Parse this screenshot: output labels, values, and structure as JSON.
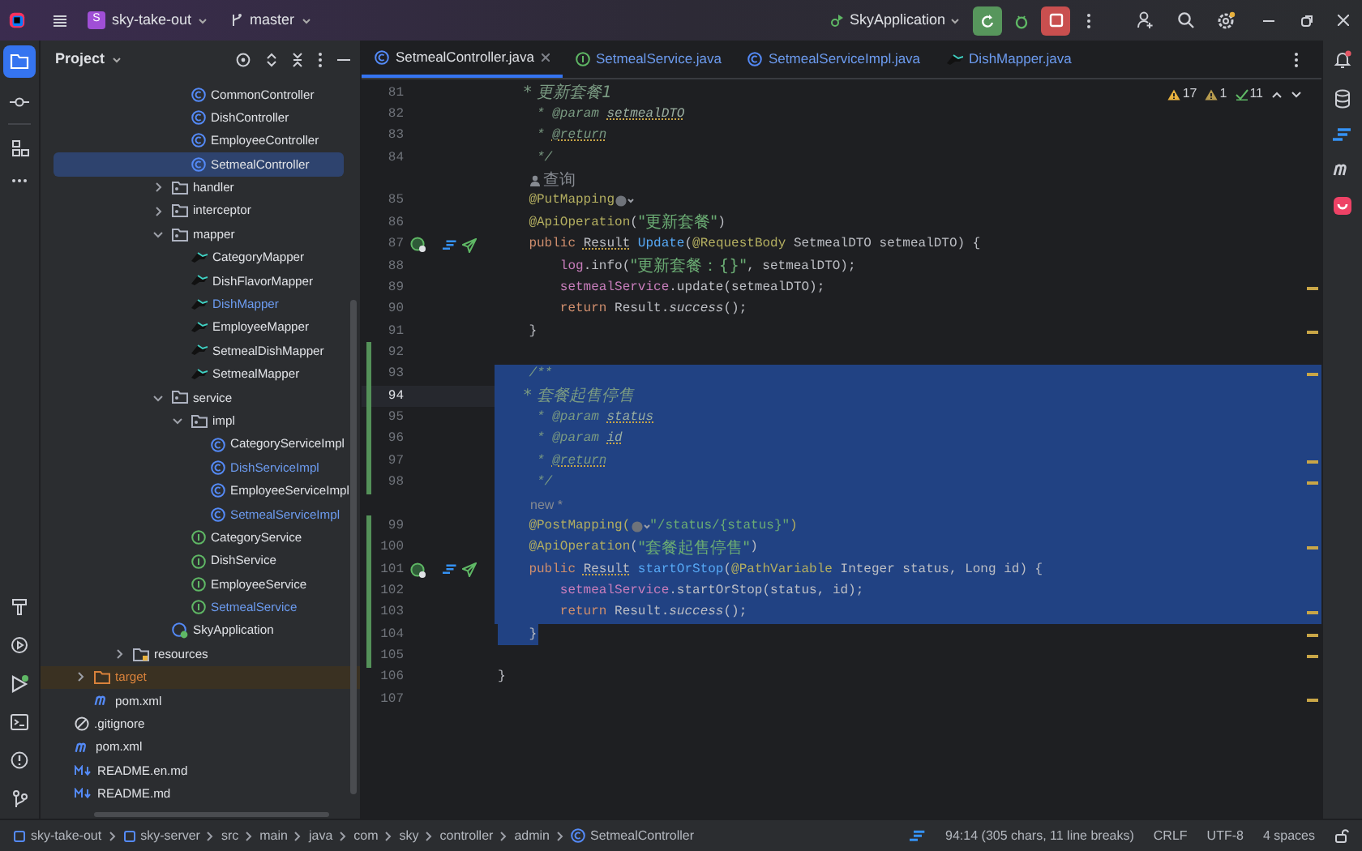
{
  "title_bar": {
    "project_badge": "S",
    "project": "sky-take-out",
    "branch": "master",
    "run_config": "SkyApplication"
  },
  "tool_window": {
    "title": "Project"
  },
  "tree": [
    {
      "children": [
        {
          "children": [
            {
              "children": [
                {
                  "children": [
                    {
                      "children": [
                        {
                          "children": [
                            {
                              "label": "CommonController",
                              "kind": "class",
                              "modified": false,
                              "selected": false
                            },
                            {
                              "label": "DishController",
                              "kind": "class",
                              "modified": false,
                              "selected": false
                            },
                            {
                              "label": "EmployeeController",
                              "kind": "class",
                              "modified": false,
                              "selected": false
                            },
                            {
                              "label": "SetmealController",
                              "kind": "class",
                              "modified": false,
                              "selected": true
                            }
                          ]
                        },
                        {
                          "label": "handler",
                          "kind": "package",
                          "modified": false,
                          "selected": false,
                          "expanded": false
                        },
                        {
                          "label": "interceptor",
                          "kind": "package",
                          "modified": false,
                          "selected": false,
                          "expanded": false
                        },
                        {
                          "label": "mapper",
                          "kind": "package",
                          "modified": false,
                          "selected": false,
                          "expanded": true,
                          "children": [
                            {
                              "label": "CategoryMapper",
                              "kind": "mapper",
                              "modified": false,
                              "selected": false
                            },
                            {
                              "label": "DishFlavorMapper",
                              "kind": "mapper",
                              "modified": false,
                              "selected": false
                            },
                            {
                              "label": "DishMapper",
                              "kind": "mapper",
                              "modified": true,
                              "selected": false
                            },
                            {
                              "label": "EmployeeMapper",
                              "kind": "mapper",
                              "modified": false,
                              "selected": false
                            },
                            {
                              "label": "SetmealDishMapper",
                              "kind": "mapper",
                              "modified": false,
                              "selected": false
                            },
                            {
                              "label": "SetmealMapper",
                              "kind": "mapper",
                              "modified": false,
                              "selected": false
                            }
                          ]
                        },
                        {
                          "label": "service",
                          "kind": "package",
                          "modified": false,
                          "selected": false,
                          "expanded": true,
                          "children": [
                            {
                              "label": "impl",
                              "kind": "package",
                              "modified": false,
                              "selected": false,
                              "expanded": true,
                              "children": [
                                {
                                  "label": "CategoryServiceImpl",
                                  "kind": "class",
                                  "modified": false,
                                  "selected": false
                                },
                                {
                                  "label": "DishServiceImpl",
                                  "kind": "class",
                                  "modified": true,
                                  "selected": false
                                },
                                {
                                  "label": "EmployeeServiceImpl",
                                  "kind": "class",
                                  "modified": false,
                                  "selected": false
                                },
                                {
                                  "label": "SetmealServiceImpl",
                                  "kind": "class",
                                  "modified": true,
                                  "selected": false
                                }
                              ]
                            },
                            {
                              "label": "CategoryService",
                              "kind": "interface",
                              "modified": false,
                              "selected": false
                            },
                            {
                              "label": "DishService",
                              "kind": "interface",
                              "modified": false,
                              "selected": false
                            },
                            {
                              "label": "EmployeeService",
                              "kind": "interface",
                              "modified": false,
                              "selected": false
                            },
                            {
                              "label": "SetmealService",
                              "kind": "interface",
                              "modified": true,
                              "selected": false
                            }
                          ]
                        },
                        {
                          "label": "SkyApplication",
                          "kind": "app",
                          "modified": false,
                          "selected": false
                        }
                      ]
                    }
                  ]
                },
                {
                  "label": "resources",
                  "kind": "resources",
                  "modified": false,
                  "selected": false,
                  "expanded": false
                }
              ]
            }
          ]
        },
        {
          "label": "target",
          "kind": "excluded_folder",
          "modified": false,
          "selected": false,
          "expanded": false
        },
        {
          "label": "pom.xml",
          "kind": "maven",
          "modified": false,
          "selected": false
        }
      ]
    },
    {
      "label": ".gitignore",
      "kind": "ignore",
      "modified": false,
      "selected": false
    },
    {
      "label": "pom.xml",
      "kind": "maven",
      "modified": false,
      "selected": false
    },
    {
      "label": "README.en.md",
      "kind": "markdown",
      "modified": false,
      "selected": false
    },
    {
      "label": "README.md",
      "kind": "markdown",
      "modified": false,
      "selected": false
    }
  ],
  "tabs": [
    {
      "label": "SetmealController.java",
      "kind": "class",
      "selected": true
    },
    {
      "label": "SetmealService.java",
      "kind": "interface",
      "selected": false
    },
    {
      "label": "SetmealServiceImpl.java",
      "kind": "class",
      "selected": false
    },
    {
      "label": "DishMapper.java",
      "kind": "mapper",
      "selected": false
    }
  ],
  "inspections": [
    {
      "kind": "warning",
      "count": "17"
    },
    {
      "kind": "weak",
      "count": "1"
    },
    {
      "kind": "ok",
      "count": "11"
    }
  ],
  "code": [
    {
      "kind": "code",
      "number": "81",
      "selected": false,
      "selected_to_end": false,
      "current": false,
      "changed": false,
      "run_markers": false,
      "stripe": false,
      "segments": [
        {
          "kind": "comment",
          "text": "     * 更新套餐1"
        }
      ]
    },
    {
      "kind": "code",
      "number": "82",
      "selected": false,
      "selected_to_end": false,
      "current": false,
      "changed": false,
      "run_markers": false,
      "stripe": false,
      "segments": [
        {
          "kind": "comment",
          "text": "     * "
        },
        {
          "kind": "comment_tag",
          "text": "@param "
        },
        {
          "kind": "comment_ref",
          "text": "setmealDTO"
        }
      ]
    },
    {
      "kind": "code",
      "number": "83",
      "selected": false,
      "selected_to_end": false,
      "current": false,
      "changed": false,
      "run_markers": false,
      "stripe": false,
      "segments": [
        {
          "kind": "comment",
          "text": "     * "
        },
        {
          "kind": "comment_tag_warn",
          "text": "@return"
        }
      ]
    },
    {
      "kind": "code",
      "number": "84",
      "selected": false,
      "selected_to_end": false,
      "current": false,
      "changed": false,
      "run_markers": false,
      "stripe": false,
      "segments": [
        {
          "kind": "comment",
          "text": "     */"
        }
      ]
    },
    {
      "kind": "author_hint",
      "text": "查询",
      "selected": false,
      "selected_to_end": false
    },
    {
      "kind": "code",
      "number": "85",
      "selected": false,
      "selected_to_end": false,
      "current": false,
      "changed": false,
      "run_markers": false,
      "stripe": false,
      "segments": [
        {
          "kind": "annotation",
          "text": "    @PutMapping"
        },
        {
          "kind": "globe"
        }
      ]
    },
    {
      "kind": "code",
      "number": "86",
      "selected": false,
      "selected_to_end": false,
      "current": false,
      "changed": false,
      "run_markers": false,
      "stripe": false,
      "segments": [
        {
          "kind": "annotation",
          "text": "    @ApiOperation"
        },
        {
          "kind": "plain",
          "text": "("
        },
        {
          "kind": "string",
          "text": "\"更新套餐\""
        },
        {
          "kind": "plain",
          "text": ")"
        }
      ]
    },
    {
      "kind": "code",
      "number": "87",
      "selected": false,
      "selected_to_end": false,
      "current": false,
      "changed": false,
      "run_markers": true,
      "stripe": false,
      "segments": [
        {
          "kind": "keyword",
          "text": "    public "
        },
        {
          "kind": "type_warn",
          "text": "Result"
        },
        {
          "kind": "method",
          "text": " Update"
        },
        {
          "kind": "plain",
          "text": "("
        },
        {
          "kind": "annotation",
          "text": "@RequestBody"
        },
        {
          "kind": "plain",
          "text": " SetmealDTO setmealDTO) {"
        }
      ]
    },
    {
      "kind": "code",
      "number": "88",
      "selected": false,
      "selected_to_end": false,
      "current": false,
      "changed": false,
      "run_markers": false,
      "stripe": false,
      "segments": [
        {
          "kind": "field",
          "text": "        log"
        },
        {
          "kind": "plain",
          "text": ".info("
        },
        {
          "kind": "string",
          "text": "\"更新套餐：{}\""
        },
        {
          "kind": "plain",
          "text": ", setmealDTO);"
        }
      ]
    },
    {
      "kind": "code",
      "number": "89",
      "selected": false,
      "selected_to_end": false,
      "current": false,
      "changed": false,
      "run_markers": false,
      "stripe": true,
      "segments": [
        {
          "kind": "field",
          "text": "        setmealService"
        },
        {
          "kind": "plain",
          "text": ".update(setmealDTO);"
        }
      ]
    },
    {
      "kind": "code",
      "number": "90",
      "selected": false,
      "selected_to_end": false,
      "current": false,
      "changed": false,
      "run_markers": false,
      "stripe": false,
      "segments": [
        {
          "kind": "keyword",
          "text": "        return "
        },
        {
          "kind": "plain",
          "text": "Result."
        },
        {
          "kind": "italic",
          "text": "success"
        },
        {
          "kind": "plain",
          "text": "();"
        }
      ]
    },
    {
      "kind": "code",
      "number": "91",
      "selected": false,
      "selected_to_end": false,
      "current": false,
      "changed": false,
      "run_markers": false,
      "stripe": true,
      "segments": [
        {
          "kind": "plain",
          "text": "    }"
        }
      ]
    },
    {
      "kind": "code",
      "number": "92",
      "selected": false,
      "selected_to_end": false,
      "current": false,
      "changed": true,
      "run_markers": false,
      "stripe": false
    },
    {
      "kind": "code",
      "number": "93",
      "selected": true,
      "selected_to_end": true,
      "current": false,
      "changed": true,
      "run_markers": false,
      "stripe": true,
      "segments": [
        {
          "kind": "comment",
          "text": "    /**"
        }
      ]
    },
    {
      "kind": "code",
      "number": "94",
      "selected": true,
      "selected_to_end": true,
      "current": true,
      "changed": true,
      "run_markers": false,
      "stripe": false,
      "segments": [
        {
          "kind": "comment",
          "text": "     * 套餐起售停售"
        }
      ]
    },
    {
      "kind": "code",
      "number": "95",
      "selected": true,
      "selected_to_end": true,
      "current": false,
      "changed": true,
      "run_markers": false,
      "stripe": false,
      "segments": [
        {
          "kind": "comment",
          "text": "     * "
        },
        {
          "kind": "comment_tag",
          "text": "@param "
        },
        {
          "kind": "comment_ref",
          "text": "status"
        }
      ]
    },
    {
      "kind": "code",
      "number": "96",
      "selected": true,
      "selected_to_end": true,
      "current": false,
      "changed": true,
      "run_markers": false,
      "stripe": false,
      "segments": [
        {
          "kind": "comment",
          "text": "     * "
        },
        {
          "kind": "comment_tag",
          "text": "@param "
        },
        {
          "kind": "comment_ref",
          "text": "id"
        }
      ]
    },
    {
      "kind": "code",
      "number": "97",
      "selected": true,
      "selected_to_end": true,
      "current": false,
      "changed": true,
      "run_markers": false,
      "stripe": true,
      "segments": [
        {
          "kind": "comment",
          "text": "     * "
        },
        {
          "kind": "comment_tag_warn",
          "text": "@return"
        }
      ]
    },
    {
      "kind": "code",
      "number": "98",
      "selected": true,
      "selected_to_end": true,
      "current": false,
      "changed": true,
      "run_markers": false,
      "stripe": true,
      "segments": [
        {
          "kind": "comment",
          "text": "     */"
        }
      ]
    },
    {
      "kind": "hint",
      "text": "new *",
      "selected": true,
      "selected_to_end": true
    },
    {
      "kind": "code",
      "number": "99",
      "selected": true,
      "selected_to_end": true,
      "current": false,
      "changed": true,
      "run_markers": false,
      "stripe": false,
      "segments": [
        {
          "kind": "annotation",
          "text": "    @PostMapping("
        },
        {
          "kind": "globe"
        },
        {
          "kind": "string",
          "text": "\"/status/{status}\""
        },
        {
          "kind": "annotation",
          "text": ")"
        }
      ]
    },
    {
      "kind": "code",
      "number": "100",
      "selected": true,
      "selected_to_end": true,
      "current": false,
      "changed": true,
      "run_markers": false,
      "stripe": true,
      "segments": [
        {
          "kind": "annotation",
          "text": "    @ApiOperation"
        },
        {
          "kind": "plain",
          "text": "("
        },
        {
          "kind": "string",
          "text": "\"套餐起售停售\""
        },
        {
          "kind": "plain",
          "text": ")"
        }
      ]
    },
    {
      "kind": "code",
      "number": "101",
      "selected": true,
      "selected_to_end": true,
      "current": false,
      "changed": true,
      "run_markers": true,
      "stripe": false,
      "segments": [
        {
          "kind": "keyword",
          "text": "    public "
        },
        {
          "kind": "type_warn",
          "text": "Result"
        },
        {
          "kind": "method",
          "text": " startOrStop"
        },
        {
          "kind": "plain",
          "text": "("
        },
        {
          "kind": "annotation",
          "text": "@PathVariable"
        },
        {
          "kind": "plain",
          "text": " Integer status, Long id) {"
        }
      ]
    },
    {
      "kind": "code",
      "number": "102",
      "selected": true,
      "selected_to_end": true,
      "current": false,
      "changed": true,
      "run_markers": false,
      "stripe": false,
      "segments": [
        {
          "kind": "field",
          "text": "        setmealService"
        },
        {
          "kind": "plain",
          "text": ".startOrStop(status, id);"
        }
      ]
    },
    {
      "kind": "code",
      "number": "103",
      "selected": true,
      "selected_to_end": true,
      "current": false,
      "changed": true,
      "run_markers": false,
      "stripe": true,
      "segments": [
        {
          "kind": "keyword",
          "text": "        return "
        },
        {
          "kind": "plain",
          "text": "Result."
        },
        {
          "kind": "italic",
          "text": "success"
        },
        {
          "kind": "plain",
          "text": "();"
        }
      ]
    },
    {
      "kind": "code",
      "number": "104",
      "selected": true,
      "selected_to_end": false,
      "current": false,
      "changed": true,
      "run_markers": false,
      "stripe": true,
      "segments": [
        {
          "kind": "plain",
          "text": "    }"
        }
      ]
    },
    {
      "kind": "code",
      "number": "105",
      "selected": false,
      "selected_to_end": false,
      "current": false,
      "changed": true,
      "run_markers": false,
      "stripe": true
    },
    {
      "kind": "code",
      "number": "106",
      "selected": false,
      "selected_to_end": false,
      "current": false,
      "changed": false,
      "run_markers": false,
      "stripe": false,
      "segments": [
        {
          "kind": "plain",
          "text": "}"
        }
      ]
    },
    {
      "kind": "code",
      "number": "107",
      "selected": false,
      "selected_to_end": false,
      "current": false,
      "changed": false,
      "run_markers": false,
      "stripe": true
    }
  ],
  "breadcrumbs": [
    {
      "label": "sky-take-out",
      "kind": "module"
    },
    {
      "label": "sky-server",
      "kind": "module"
    },
    {
      "label": "src",
      "kind": "plain"
    },
    {
      "label": "main",
      "kind": "plain"
    },
    {
      "label": "java",
      "kind": "plain"
    },
    {
      "label": "com",
      "kind": "plain"
    },
    {
      "label": "sky",
      "kind": "plain"
    },
    {
      "label": "controller",
      "kind": "plain"
    },
    {
      "label": "admin",
      "kind": "plain"
    },
    {
      "label": "SetmealController",
      "kind": "class"
    }
  ],
  "status": {
    "position": "94:14 (305 chars, 11 line breaks)",
    "line_separator": "CRLF",
    "encoding": "UTF-8",
    "indent": "4 spaces"
  }
}
